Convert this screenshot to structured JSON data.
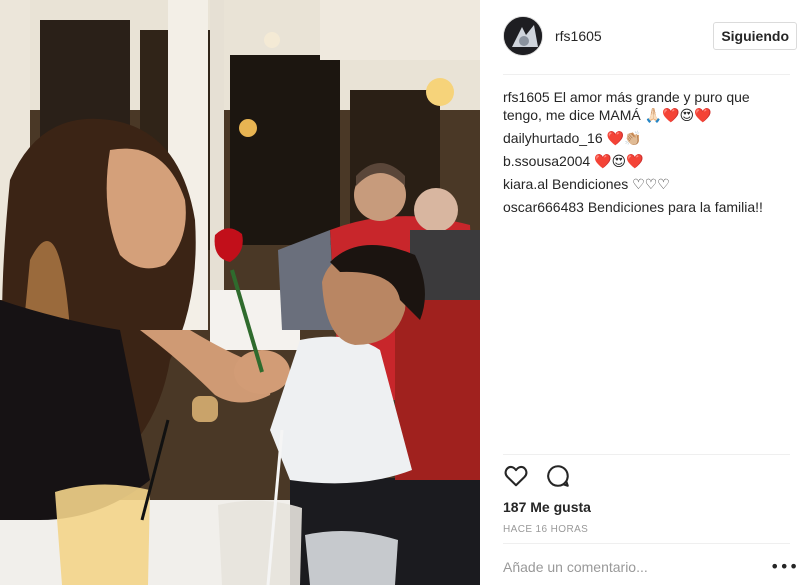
{
  "post": {
    "username": "rfs1605",
    "follow_label": "Siguiendo",
    "caption": {
      "user": "rfs1605",
      "text": "El amor más grande y puro que tengo, me dice MAMÁ 🙏🏻❤️😍❤️"
    },
    "comments": [
      {
        "user": "dailyhurtado_16",
        "text": "❤️👏🏼"
      },
      {
        "user": "b.ssousa2004",
        "text": "❤️😍❤️"
      },
      {
        "user": "kiara.al",
        "text": "Bendiciones ♡♡♡"
      },
      {
        "user": "oscar666483",
        "text": "Bendiciones para la familia!!"
      }
    ],
    "likes_text": "187 Me gusta",
    "timestamp": "HACE 16 HORAS",
    "comment_placeholder": "Añade un comentario...",
    "more_label": "•••",
    "icons": {
      "like": "heart-outline-icon",
      "comment": "speech-bubble-icon"
    }
  }
}
